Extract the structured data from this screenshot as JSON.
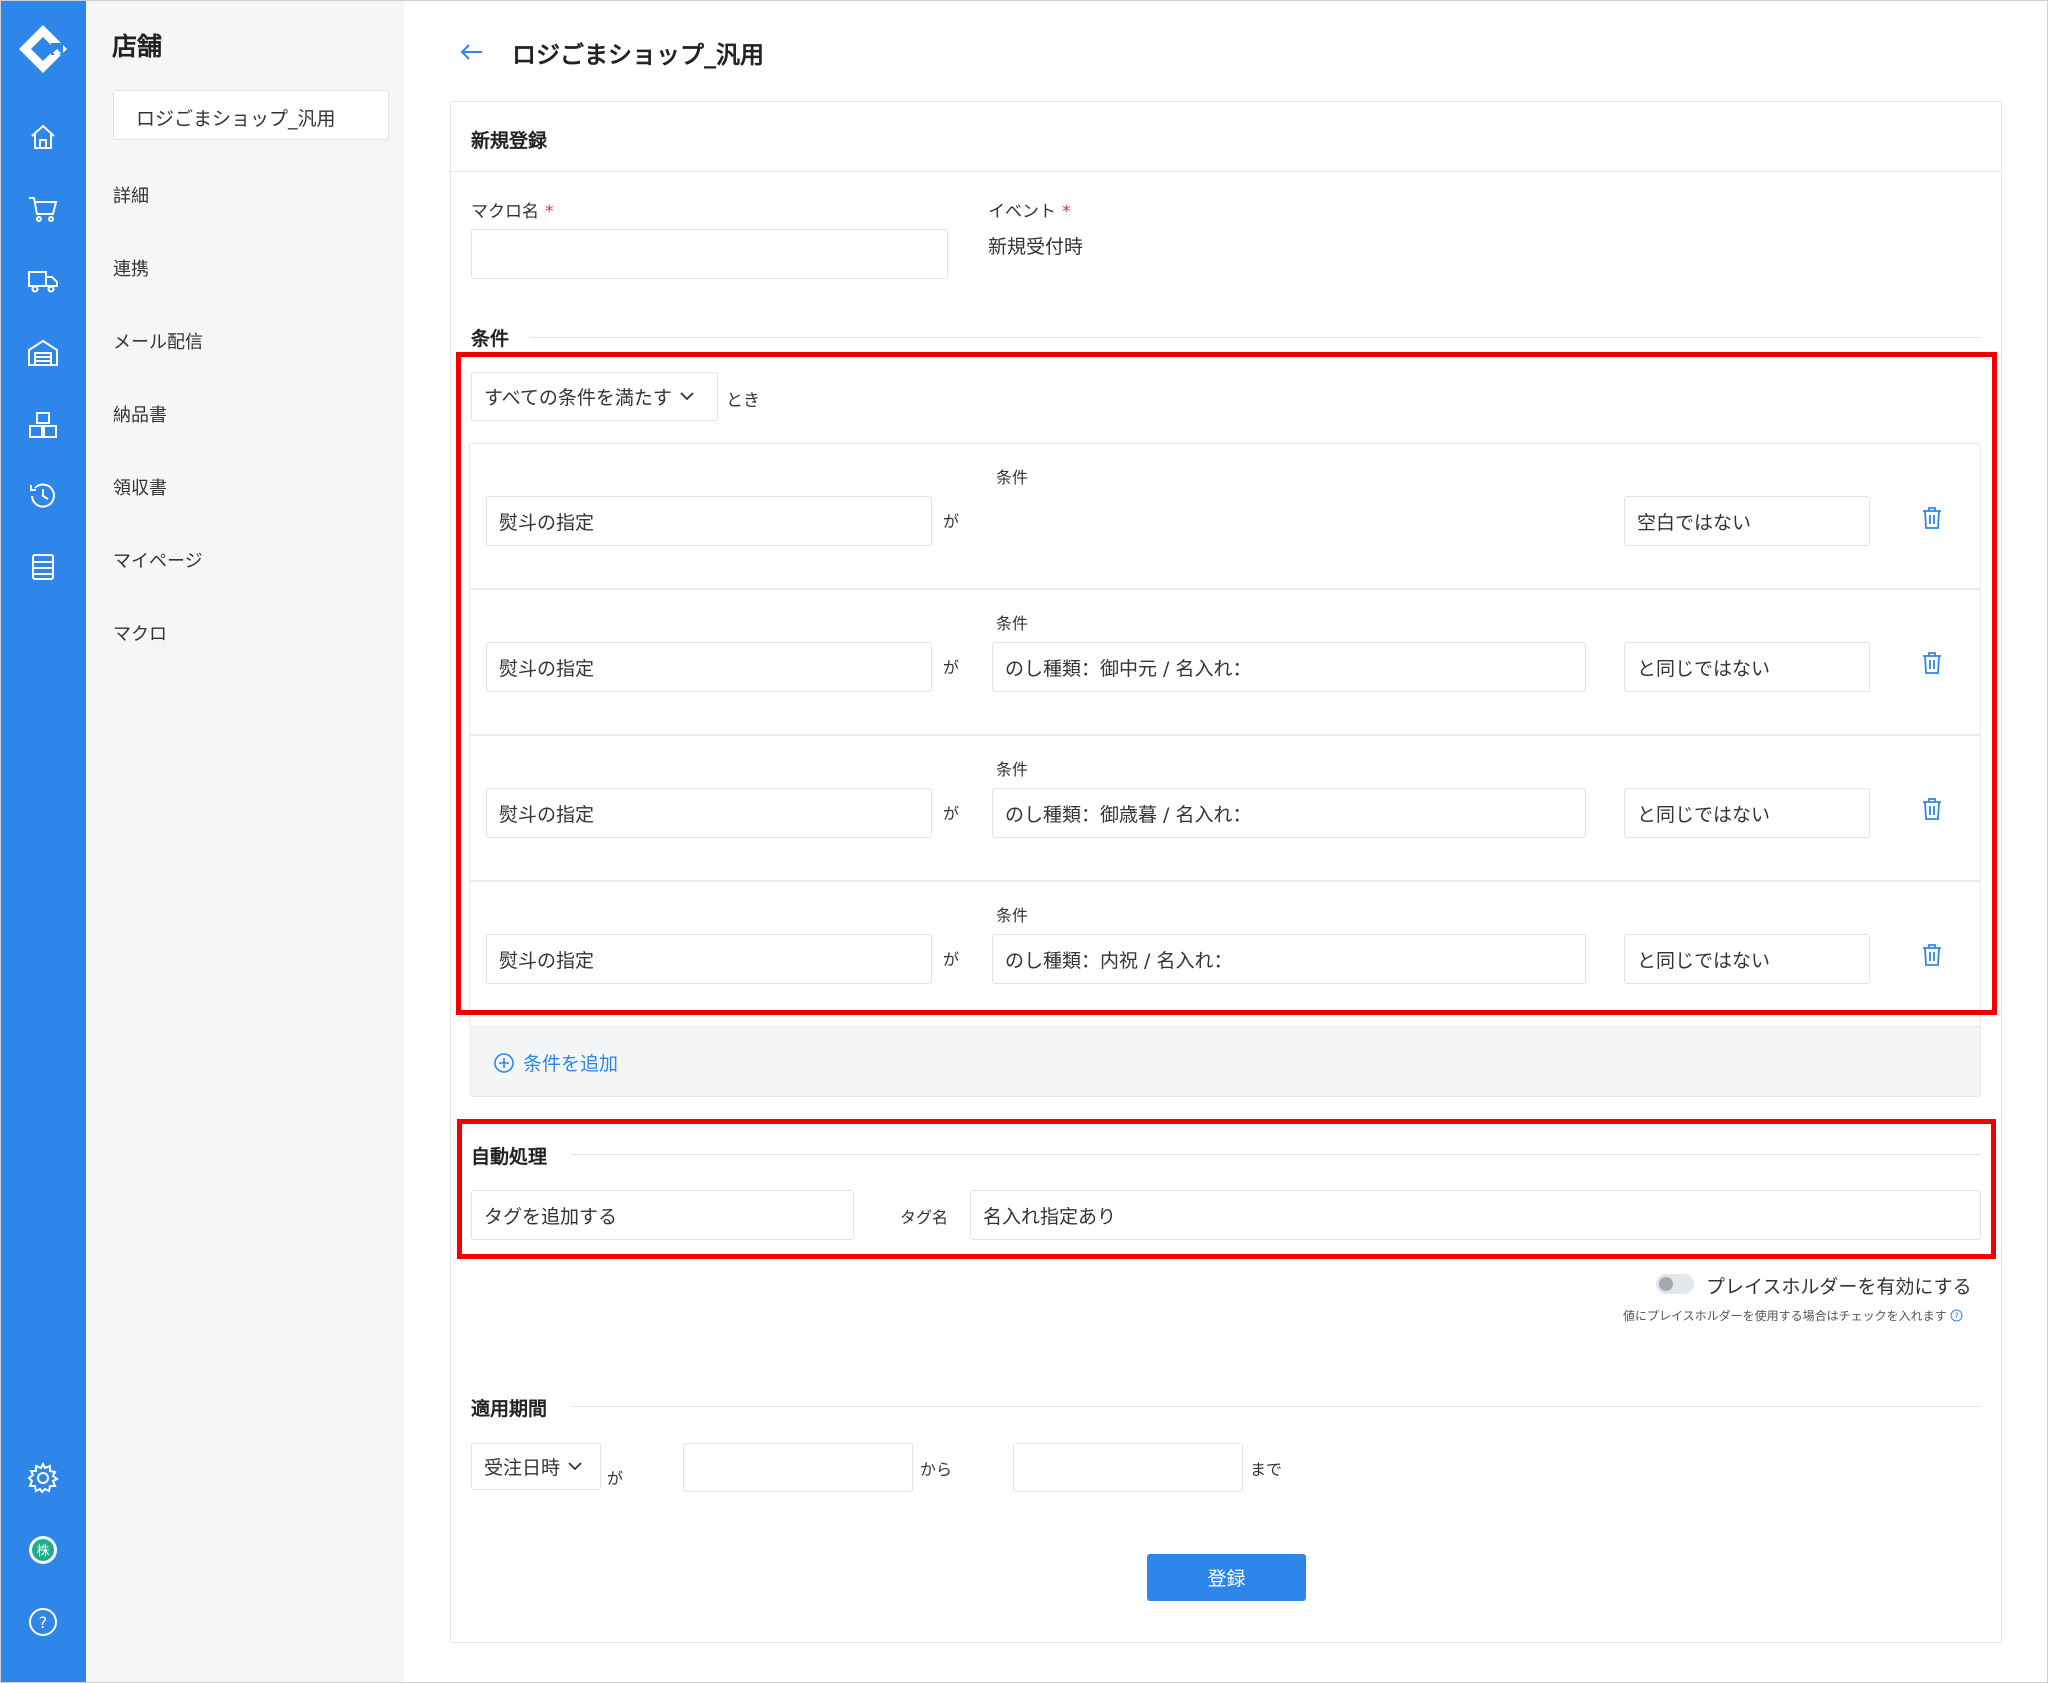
{
  "app": {
    "rail_icons": [
      "logo-icon",
      "home-icon",
      "cart-icon",
      "truck-icon",
      "warehouse-icon",
      "boxes-icon",
      "history-icon",
      "list-icon",
      "gear-icon",
      "company-icon",
      "help-icon"
    ],
    "company_icon_char": "株",
    "help_icon_char": "?",
    "accent_color": "#2f86ea",
    "highlight_color": "#f20000"
  },
  "sidebar": {
    "title": "店舗",
    "shop_name": "ロジごまショップ_汎用",
    "items": [
      {
        "label": "詳細"
      },
      {
        "label": "連携"
      },
      {
        "label": "メール配信"
      },
      {
        "label": "納品書"
      },
      {
        "label": "領収書"
      },
      {
        "label": "マイページ"
      },
      {
        "label": "マクロ"
      }
    ]
  },
  "header": {
    "title": "ロジごまショップ_汎用"
  },
  "form": {
    "card_title": "新規登録",
    "macro_name_label": "マクロ名",
    "macro_name_value": "",
    "event_label": "イベント",
    "event_value": "新規受付時",
    "required_mark": "*",
    "conditions": {
      "section_title": "条件",
      "match_mode": "すべての条件を満たす",
      "match_suffix": "とき",
      "rows": [
        {
          "field": "熨斗の指定",
          "particle": "が",
          "condition_label": "条件",
          "value": "",
          "operator": "空白ではない"
        },
        {
          "field": "熨斗の指定",
          "particle": "が",
          "condition_label": "条件",
          "value": "のし種類：御中元 / 名入れ：",
          "operator": "と同じではない"
        },
        {
          "field": "熨斗の指定",
          "particle": "が",
          "condition_label": "条件",
          "value": "のし種類：御歳暮 / 名入れ：",
          "operator": "と同じではない"
        },
        {
          "field": "熨斗の指定",
          "particle": "が",
          "condition_label": "条件",
          "value": "のし種類：内祝 / 名入れ：",
          "operator": "と同じではない"
        }
      ],
      "add_label": "条件を追加"
    },
    "auto_action": {
      "section_title": "自動処理",
      "action": "タグを追加する",
      "tag_label": "タグ名",
      "tag_value": "名入れ指定あり"
    },
    "placeholder_toggle": {
      "label": "プレイスホルダーを有効にする",
      "enabled": false,
      "hint": "値にプレイスホルダーを使用する場合はチェックを入れます"
    },
    "period": {
      "section_title": "適用期間",
      "basis": "受注日時",
      "particle": "が",
      "from_value": "",
      "from_label": "から",
      "to_value": "",
      "to_label": "まで"
    },
    "submit_label": "登録"
  }
}
